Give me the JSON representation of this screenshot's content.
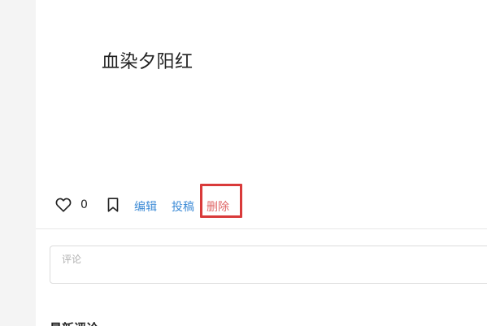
{
  "post": {
    "text": "血染夕阳红"
  },
  "actions": {
    "like_count": "0",
    "edit_label": "编辑",
    "submit_label": "投稿",
    "delete_label": "删除"
  },
  "comment": {
    "placeholder": "评论"
  },
  "sections": {
    "latest_comments_heading": "最新评论"
  },
  "icons": {
    "like": "heart-outline-icon",
    "bookmark": "bookmark-outline-icon"
  },
  "colors": {
    "link": "#3d8bd6",
    "delete": "#e06666",
    "highlight": "#d93a3a"
  }
}
